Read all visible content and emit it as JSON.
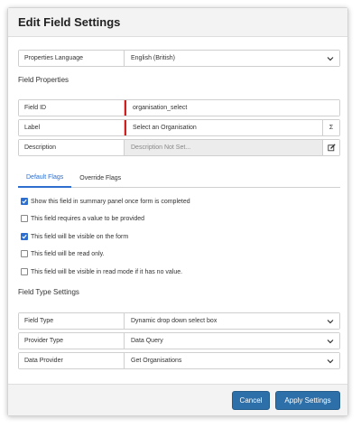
{
  "dialog": {
    "title": "Edit Field Settings"
  },
  "properties_language": {
    "label": "Properties Language",
    "value": "English (British)"
  },
  "field_properties": {
    "heading": "Field Properties",
    "field_id": {
      "label": "Field ID",
      "value": "organisation_select"
    },
    "label": {
      "label": "Label",
      "value": "Select an Organisation",
      "sigma": "Σ"
    },
    "description": {
      "label": "Description",
      "placeholder": "Description Not Set..."
    }
  },
  "tabs": [
    {
      "label": "Default Flags",
      "active": true
    },
    {
      "label": "Override Flags",
      "active": false
    }
  ],
  "flags": [
    {
      "label": "Show this field in summary panel once form is completed",
      "checked": true
    },
    {
      "label": "This field requires a value to be provided",
      "checked": false
    },
    {
      "label": "This field will be visible on the form",
      "checked": true
    },
    {
      "label": "This field will be read only.",
      "checked": false
    },
    {
      "label": "This field will be visible in read mode if it has no value.",
      "checked": false
    }
  ],
  "field_type_settings": {
    "heading": "Field Type Settings",
    "field_type": {
      "label": "Field Type",
      "value": "Dynamic drop down select box"
    },
    "provider_type": {
      "label": "Provider Type",
      "value": "Data Query"
    },
    "data_provider": {
      "label": "Data Provider",
      "value": "Get Organisations"
    }
  },
  "footer": {
    "cancel_label": "Cancel",
    "apply_label": "Apply Settings"
  },
  "colors": {
    "accent": "#2d6ecf",
    "required": "#d41f1f",
    "button": "#2d6fa8"
  }
}
